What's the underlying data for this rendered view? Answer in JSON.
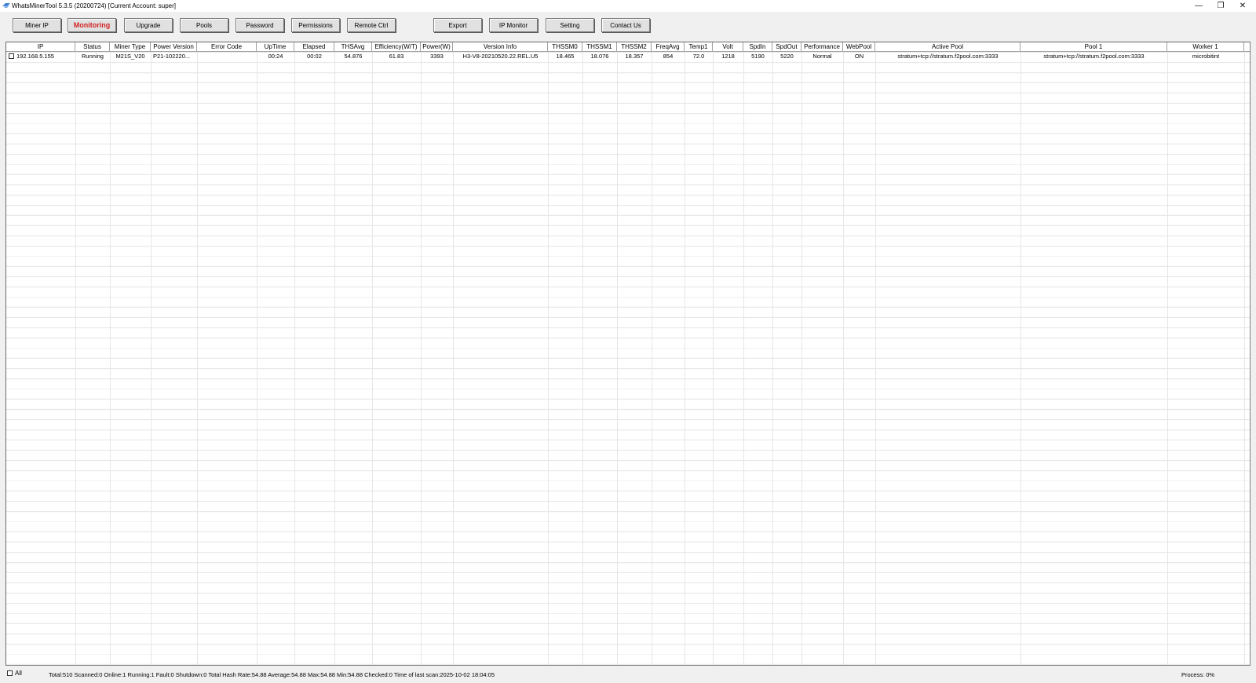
{
  "window": {
    "title": "WhatsMinerTool 5.3.5 (20200724) [Current Account: super]"
  },
  "toolbar": {
    "buttons": [
      {
        "label": "Miner IP",
        "active": false
      },
      {
        "label": "Monitoring",
        "active": true
      },
      {
        "label": "Upgrade",
        "active": false
      },
      {
        "label": "Pools",
        "active": false
      },
      {
        "label": "Password",
        "active": false
      },
      {
        "label": "Permissions",
        "active": false
      },
      {
        "label": "Remote Ctrl",
        "active": false
      },
      {
        "label": "Export",
        "active": false
      },
      {
        "label": "IP Monitor",
        "active": false
      },
      {
        "label": "Setting",
        "active": false
      },
      {
        "label": "Contact Us",
        "active": false
      }
    ]
  },
  "grid": {
    "columns": [
      "IP",
      "Status",
      "Miner Type",
      "Power Version",
      "Error Code",
      "UpTime",
      "Elapsed",
      "THSAvg",
      "Efficiency(W/T)",
      "Power(W)",
      "Version Info",
      "THSSM0",
      "THSSM1",
      "THSSM2",
      "FreqAvg",
      "Temp1",
      "Volt",
      "SpdIn",
      "SpdOut",
      "Performance",
      "WebPool",
      "Active Pool",
      "Pool 1",
      "Worker 1"
    ],
    "rows": [
      {
        "checked": false,
        "cells": [
          "192.168.5.155",
          "Running",
          "M21S_V20",
          "P21-102220...",
          "",
          "00:24",
          "00:02",
          "54.876",
          "61.83",
          "3393",
          "H3-V8-20210520.22.REL.U5",
          "18.465",
          "18.076",
          "18.357",
          "854",
          "72.0",
          "1218",
          "5190",
          "5220",
          "Normal",
          "ON",
          "stratum+tcp://stratum.f2pool.com:3333",
          "stratum+tcp://stratum.f2pool.com:3333",
          "microbitint"
        ]
      }
    ]
  },
  "statusbar": {
    "all_label": "All",
    "summary": "Total:510  Scanned:0  Online:1  Running:1  Fault:0  Shutdown:0  Total Hash Rate:54.88  Average:54.88  Max:54.88  Min:54.88  Checked:0  Time of last scan:2025-10-02 18:04:05",
    "progress": "Process: 0%"
  },
  "colors": {
    "active_button_text": "#d22222",
    "grid_line": "#e6e6e6"
  }
}
